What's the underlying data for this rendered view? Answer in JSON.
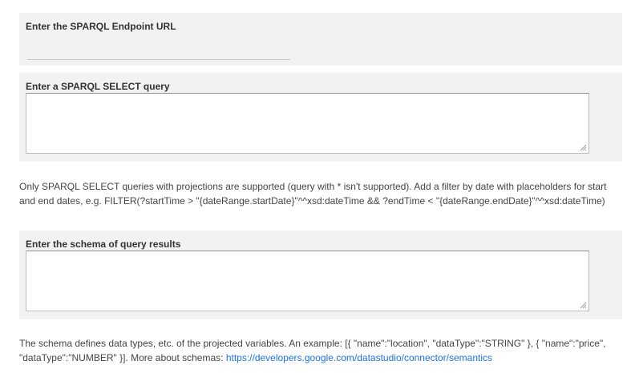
{
  "endpoint": {
    "label": "Enter the SPARQL Endpoint URL",
    "value": "",
    "placeholder": ""
  },
  "query": {
    "label": "Enter a SPARQL SELECT query",
    "value": "",
    "help_text": "Only SPARQL SELECT queries with projections are supported (query with * isn't supported). Add a filter by date with placeholders for start and end dates, e.g. FILTER(?startTime > \"{dateRange.startDate}\"^^xsd:dateTime && ?endTime < \"{dateRange.endDate}\"^^xsd:dateTime)"
  },
  "schema": {
    "label": "Enter the schema of query results",
    "value": "",
    "help_text": "The schema defines data types, etc. of the projected variables. An example: [{ \"name\":\"location\", \"dataType\":\"STRING\" }, { \"name\":\"price\", \"dataType\":\"NUMBER\" }]. More about schemas: ",
    "help_link": "https://developers.google.com/datastudio/connector/semantics"
  },
  "icons": {
    "resize_grip": "resize-grip-icon"
  }
}
